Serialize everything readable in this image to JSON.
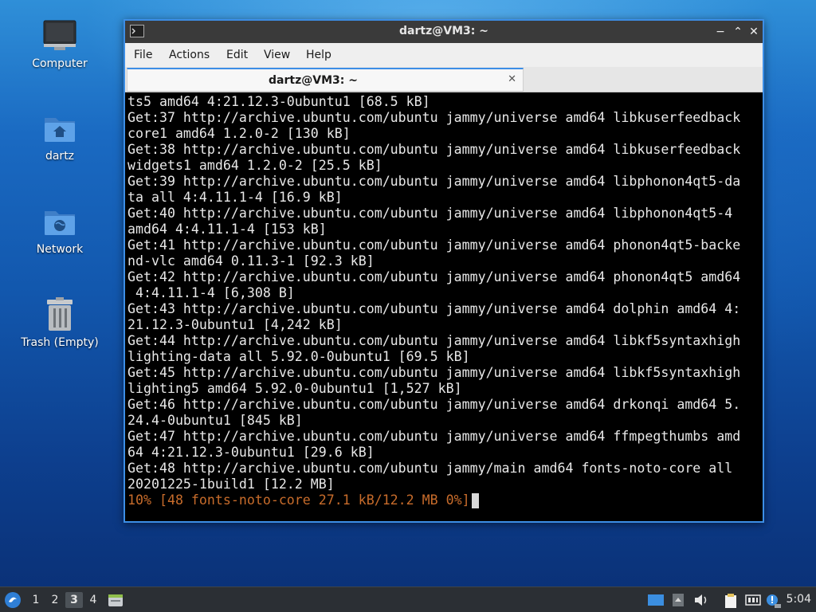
{
  "desktop": {
    "icons": [
      {
        "label": "Computer",
        "icon": "computer-icon"
      },
      {
        "label": "dartz",
        "icon": "home-folder-icon"
      },
      {
        "label": "Network",
        "icon": "network-folder-icon"
      },
      {
        "label": "Trash (Empty)",
        "icon": "trash-icon"
      }
    ]
  },
  "window": {
    "title": "dartz@VM3: ~",
    "controls": {
      "minimize": "−",
      "maximize": "⌃",
      "close": "✕"
    },
    "menu": [
      "File",
      "Actions",
      "Edit",
      "View",
      "Help"
    ],
    "tab": {
      "label": "dartz@VM3: ~",
      "close": "✕"
    }
  },
  "terminal": {
    "lines": [
      "ts5 amd64 4:21.12.3-0ubuntu1 [68.5 kB]",
      "Get:37 http://archive.ubuntu.com/ubuntu jammy/universe amd64 libkuserfeedback",
      "core1 amd64 1.2.0-2 [130 kB]",
      "Get:38 http://archive.ubuntu.com/ubuntu jammy/universe amd64 libkuserfeedback",
      "widgets1 amd64 1.2.0-2 [25.5 kB]",
      "Get:39 http://archive.ubuntu.com/ubuntu jammy/universe amd64 libphonon4qt5-da",
      "ta all 4:4.11.1-4 [16.9 kB]",
      "Get:40 http://archive.ubuntu.com/ubuntu jammy/universe amd64 libphonon4qt5-4",
      "amd64 4:4.11.1-4 [153 kB]",
      "Get:41 http://archive.ubuntu.com/ubuntu jammy/universe amd64 phonon4qt5-backe",
      "nd-vlc amd64 0.11.3-1 [92.3 kB]",
      "Get:42 http://archive.ubuntu.com/ubuntu jammy/universe amd64 phonon4qt5 amd64",
      " 4:4.11.1-4 [6,308 B]",
      "Get:43 http://archive.ubuntu.com/ubuntu jammy/universe amd64 dolphin amd64 4:",
      "21.12.3-0ubuntu1 [4,242 kB]",
      "Get:44 http://archive.ubuntu.com/ubuntu jammy/universe amd64 libkf5syntaxhigh",
      "lighting-data all 5.92.0-0ubuntu1 [69.5 kB]",
      "Get:45 http://archive.ubuntu.com/ubuntu jammy/universe amd64 libkf5syntaxhigh",
      "lighting5 amd64 5.92.0-0ubuntu1 [1,527 kB]",
      "Get:46 http://archive.ubuntu.com/ubuntu jammy/universe amd64 drkonqi amd64 5.",
      "24.4-0ubuntu1 [845 kB]",
      "Get:47 http://archive.ubuntu.com/ubuntu jammy/universe amd64 ffmpegthumbs amd",
      "64 4:21.12.3-0ubuntu1 [29.6 kB]",
      "Get:48 http://archive.ubuntu.com/ubuntu jammy/main amd64 fonts-noto-core all",
      "20201225-1build1 [12.2 MB]"
    ],
    "progress_line": "10% [48 fonts-noto-core 27.1 kB/12.2 MB 0%]",
    "colors": {
      "text": "#e8e8e8",
      "progress": "#c86c2b",
      "background": "#000000"
    }
  },
  "taskbar": {
    "workspaces": [
      "1",
      "2",
      "3",
      "4"
    ],
    "active_workspace": "3",
    "tray_icons": [
      "desktop-icon",
      "show-desktop-icon",
      "volume-icon",
      "clipboard-icon",
      "network-monitor-icon",
      "update-notifier-icon"
    ],
    "clock": "5:04"
  },
  "theme": {
    "accent": "#3c8ee6",
    "titlebar": "#3a3a3a",
    "taskbar": "#2b2f34"
  }
}
